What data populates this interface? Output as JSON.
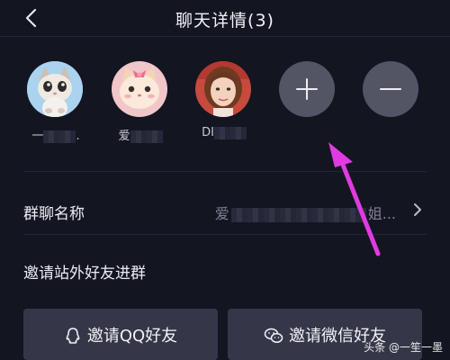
{
  "header": {
    "title": "聊天详情(3)"
  },
  "members": [
    {
      "name_prefix": "一",
      "name_suffix": ".",
      "avatar": "cat-cartoon-avatar"
    },
    {
      "name_prefix": "爱",
      "name_suffix": "",
      "avatar": "pink-cat-avatar"
    },
    {
      "name_prefix": "DI",
      "name_suffix": "",
      "avatar": "woman-photo-avatar"
    }
  ],
  "actions": {
    "add": "plus-icon",
    "remove": "minus-icon"
  },
  "group_name_row": {
    "label": "群聊名称",
    "value_prefix": "爱",
    "value_suffix": "姐...",
    "icon": "chevron-right-icon"
  },
  "invite_outside_row": {
    "label": "邀请站外好友进群"
  },
  "buttons": {
    "invite_qq": "邀请QQ好友",
    "invite_wechat": "邀请微信好友"
  },
  "watermark": "头条 @一笙一墨",
  "colors": {
    "background": "#131521",
    "button": "#353749",
    "circle_button": "#535565",
    "annotation_arrow": "#e03be0"
  }
}
